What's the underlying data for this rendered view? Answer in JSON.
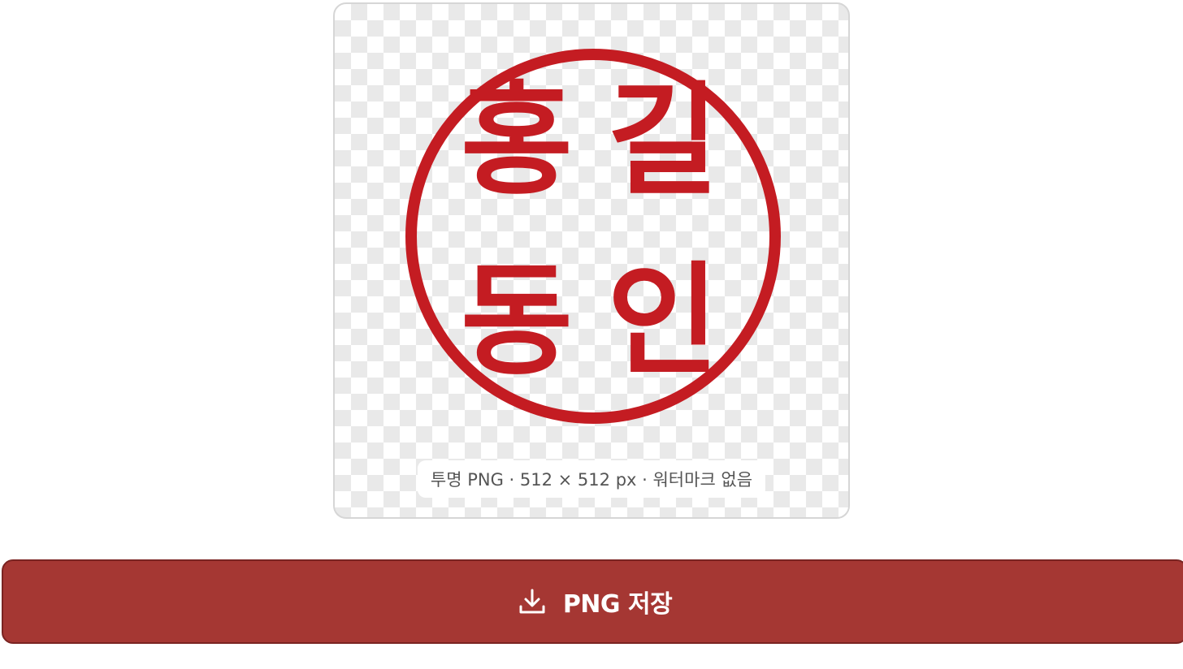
{
  "preview": {
    "seal_text": [
      "홍",
      "길",
      "동",
      "인"
    ],
    "seal_color": "#c41c22",
    "info": "투명 PNG · 512 × 512 px · 워터마크 없음"
  },
  "actions": {
    "save_label": "PNG 저장",
    "save_icon": "download-icon",
    "button_color": "#a53733"
  }
}
